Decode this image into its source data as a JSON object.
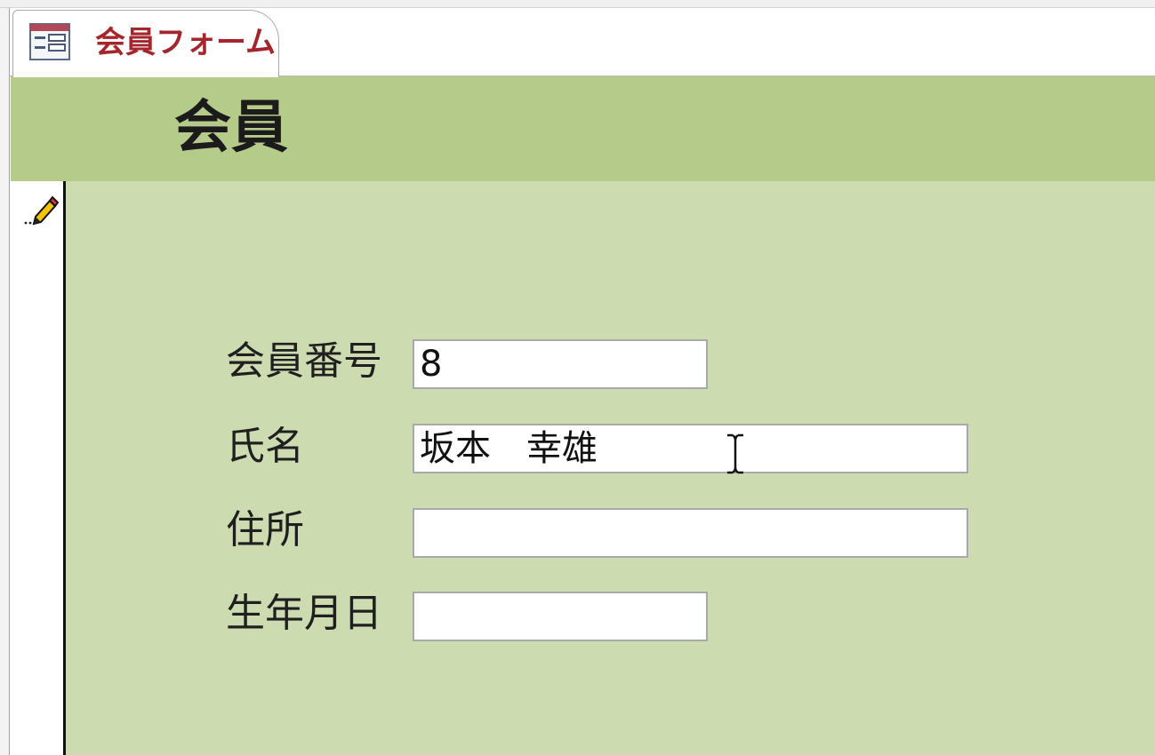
{
  "tab": {
    "label": "会員フォーム",
    "icon": "form-icon"
  },
  "header": {
    "title": "会員"
  },
  "record_selector": {
    "icon": "pencil-edit-icon"
  },
  "fields": {
    "member_number": {
      "label": "会員番号",
      "value": "8"
    },
    "name": {
      "label": "氏名",
      "value": "坂本　幸雄"
    },
    "address": {
      "label": "住所",
      "value": ""
    },
    "birthdate": {
      "label": "生年月日",
      "value": ""
    }
  },
  "colors": {
    "header_bg": "#b4cb8a",
    "detail_bg": "#cddcb0",
    "tab_label": "#a4262c"
  }
}
